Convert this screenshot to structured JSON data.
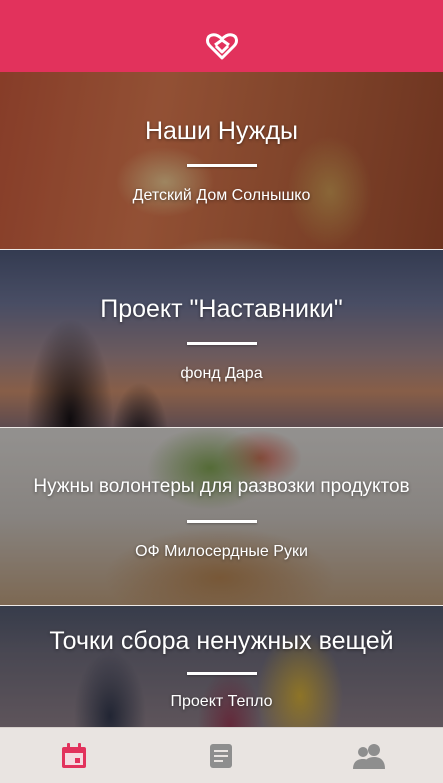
{
  "app": {
    "logo_icon": "heart-logo-icon",
    "accent_color": "#e2325c"
  },
  "cards": [
    {
      "title": "Наши Нужды",
      "subtitle": "Детский Дом Солнышко"
    },
    {
      "title": "Проект \"Наставники\"",
      "subtitle": "фонд Дара"
    },
    {
      "title": "Нужны волонтеры для развозки продуктов",
      "subtitle": "ОФ Милосердные Руки"
    },
    {
      "title": "Точки сбора ненужных вещей",
      "subtitle": "Проект Тепло"
    }
  ],
  "tabbar": {
    "active_color": "#e2325c",
    "inactive_color": "#8e8e8e",
    "tabs": [
      {
        "icon": "calendar-icon",
        "active": true
      },
      {
        "icon": "document-icon",
        "active": false
      },
      {
        "icon": "people-icon",
        "active": false
      }
    ]
  }
}
